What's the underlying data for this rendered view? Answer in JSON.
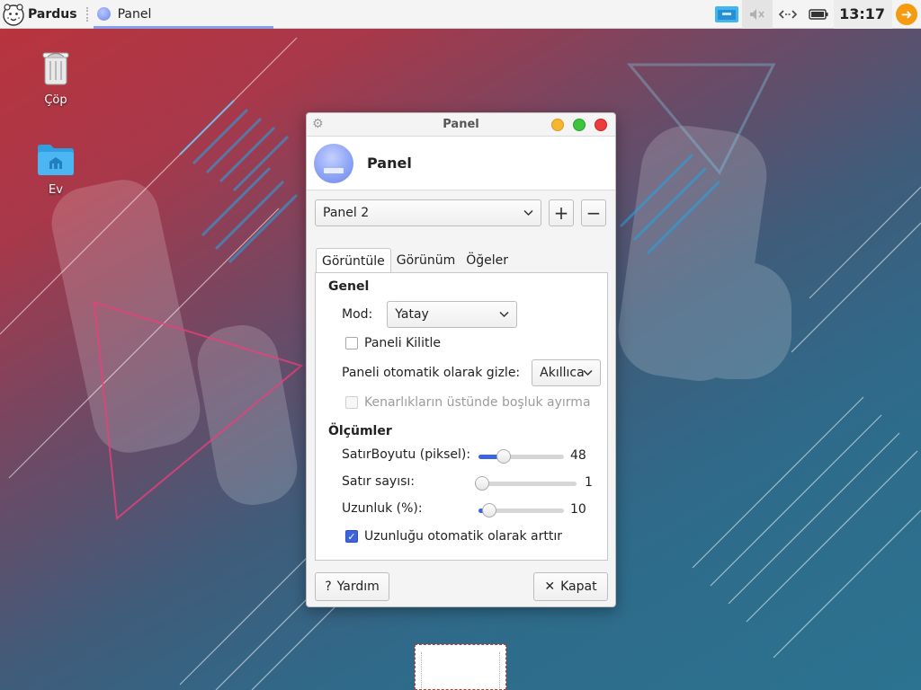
{
  "top_panel": {
    "menu_label": "Pardus",
    "task_label": "Panel",
    "clock": "13:17"
  },
  "desktop": {
    "icons": [
      {
        "label": "Çöp"
      },
      {
        "label": "Ev"
      }
    ]
  },
  "dialog": {
    "window_title": "Panel",
    "header_title": "Panel",
    "panel_select": "Panel 2",
    "add_label": "+",
    "remove_label": "−",
    "tabs": [
      "Görüntüle",
      "Görünüm",
      "Öğeler"
    ],
    "active_tab": 0,
    "general": {
      "heading": "Genel",
      "mode_label": "Mod:",
      "mode_value": "Yatay",
      "lock_label": "Paneli Kilitle",
      "lock_checked": false,
      "autohide_label": "Paneli otomatik olarak gizle:",
      "autohide_value": "Akıllıca",
      "reserve_label": "Kenarlıkların üstünde boşluk ayırma",
      "reserve_checked": false
    },
    "measurements": {
      "heading": "Ölçümler",
      "row_size_label": "SatırBoyutu (piksel):",
      "row_size_value": "48",
      "row_size_fraction": 0.25,
      "rows_label": "Satır sayısı:",
      "rows_value": "1",
      "rows_fraction": 0.0,
      "length_label": "Uzunluk (%):",
      "length_value": "10",
      "length_fraction": 0.05,
      "autoincrease_label": "Uzunluğu otomatik olarak arttır",
      "autoincrease_checked": true
    },
    "help_label": "Yardım",
    "close_label": "Kapat"
  },
  "colors": {
    "accent": "#3d63dd",
    "close_button": "#ec3c3c",
    "minimize_button": "#f5b731",
    "maximize_button": "#3ec43e",
    "logout": "#f39c12"
  }
}
